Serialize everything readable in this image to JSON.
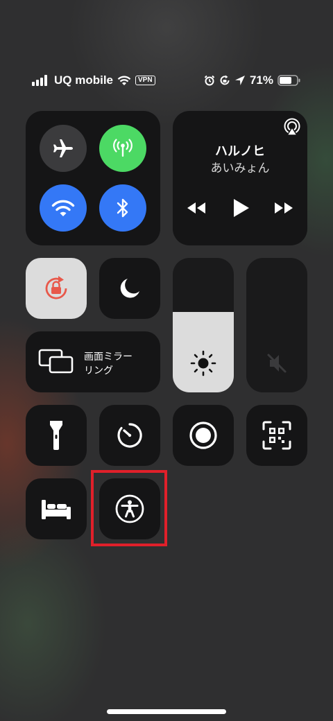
{
  "status_bar": {
    "carrier": "UQ mobile",
    "vpn": "VPN",
    "battery_percent": "71%",
    "battery_level": 0.71
  },
  "connectivity": {
    "airplane": {
      "icon": "airplane-icon",
      "on": false
    },
    "cellular": {
      "icon": "cellular-antenna-icon",
      "on": true,
      "color": "#4cd964"
    },
    "wifi": {
      "icon": "wifi-icon",
      "on": true,
      "color": "#3478f6"
    },
    "bluetooth": {
      "icon": "bluetooth-icon",
      "on": true,
      "color": "#3478f6"
    }
  },
  "now_playing": {
    "title": "ハルノヒ",
    "artist": "あいみょん"
  },
  "screen_mirroring": {
    "label_line1": "画面ミラー",
    "label_line2": "リング"
  },
  "sliders": {
    "brightness_level": 0.6,
    "volume_level": 0.0
  },
  "colors": {
    "tile": "#151516",
    "rotation_lock_bg": "#dcdcdc",
    "rotation_lock_icon": "#e8584a",
    "highlight": "#e0202a"
  }
}
